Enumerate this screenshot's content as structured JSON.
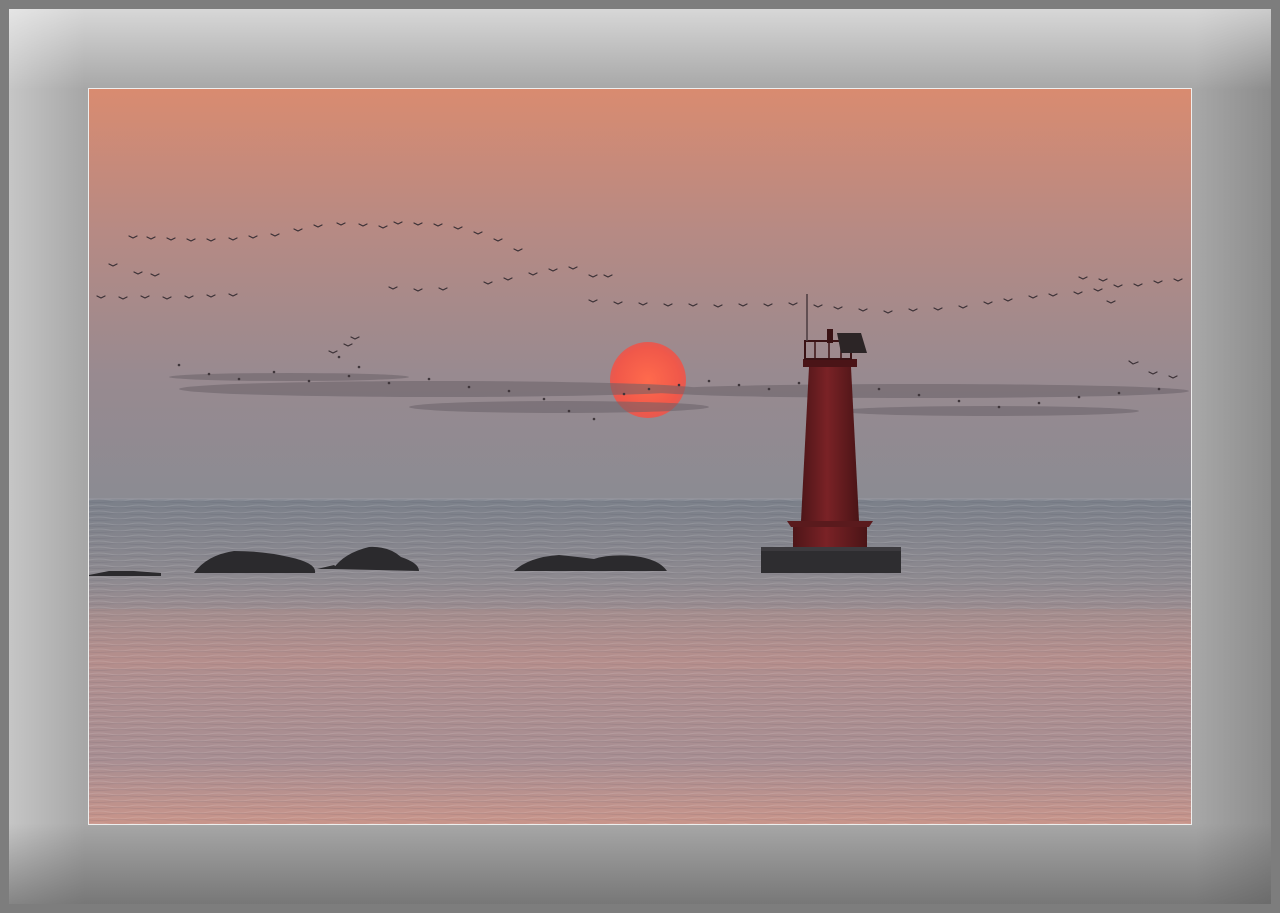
{
  "image": {
    "subject": "sunset-lighthouse-seascape",
    "colors": {
      "sky_top": "#d88a70",
      "sky_mid": "#a88a8c",
      "sky_horizon": "#8c8a90",
      "sun": "#f0584a",
      "sea_far": "#7c8189",
      "sea_near": "#c4948a",
      "lighthouse": "#6e1f22",
      "rock": "#2a2a2c",
      "frame_mat": "#a7a7a7"
    }
  }
}
